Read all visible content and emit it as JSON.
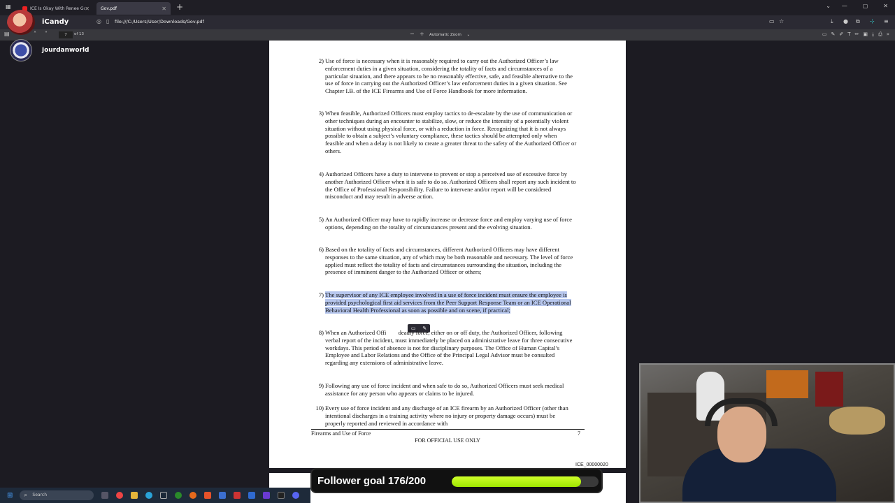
{
  "browser": {
    "tabs": [
      {
        "label": "ICE Is Okay With Renee Good's",
        "active": false
      },
      {
        "label": "Gov.pdf",
        "active": true
      }
    ],
    "url": "file:///C:/Users/User/Downloads/Gov.pdf"
  },
  "pdf_toolbar": {
    "page_current": "7",
    "page_total": "of 13",
    "zoom": "Automatic Zoom"
  },
  "overlay": {
    "user1": "iCandy",
    "user2": "jourdanworld"
  },
  "document": {
    "items": [
      {
        "num": "2)",
        "text": "Use of force is necessary when it is reasonably required to carry out the Authorized Officer’s law enforcement duties in a given situation, considering the totality of facts and circumstances of a particular situation, and there appears to be no reasonably effective, safe, and feasible alternative to the use of force in carrying out the Authorized Officer’s law enforcement duties in a given situation. See Chapter I.B. of the ICE Firearms and Use of Force Handbook for more information."
      },
      {
        "num": "3)",
        "text": "When feasible, Authorized Officers must employ tactics to de-escalate by the use of communication or other techniques during an encounter to stabilize, slow, or reduce the intensity of a potentially violent situation without using physical force, or with a reduction in force. Recognizing that it is not always possible to obtain a subject’s voluntary compliance, these tactics should be attempted only when feasible and when a delay is not likely to create a greater threat to the safety of the Authorized Officer or others."
      },
      {
        "num": "4)",
        "text": "Authorized Officers have a duty to intervene to prevent or stop a perceived use of excessive force by another Authorized Officer when it is safe to do so. Authorized Officers shall report any such incident to the Office of Professional Responsibility. Failure to intervene and/or report will be considered misconduct and may result in adverse action."
      },
      {
        "num": "5)",
        "text": "An Authorized Officer may have to rapidly increase or decrease force and employ varying use of force options, depending on the totality of circumstances present and the evolving situation."
      },
      {
        "num": "6)",
        "text": "Based on the totality of facts and circumstances, different Authorized Officers may have different responses to the same situation, any of which may be both reasonable and necessary. The level of force applied must reflect the totality of facts and circumstances surrounding the situation, including the presence of imminent danger to the Authorized Officer or others;"
      },
      {
        "num": "7)",
        "text": "The supervisor of any ICE employee involved in a use of force incident must ensure the employee is provided psychological first aid services from the Peer Support Response Team or an ICE Operational Behavioral Health Professional as soon as possible and on scene, if practical;"
      },
      {
        "num": "8)",
        "text": "When an Authorized Offi        deadly force, either on or off duty, the Authorized Officer, following verbal report of the incident, must immediately be placed on administrative leave for three consecutive workdays. This period of absence is not for disciplinary purposes. The Office of Human Capital’s Employee and Labor Relations and the Office of the Principal Legal Advisor must be consulted regarding any extensions of administrative leave."
      },
      {
        "num": "9)",
        "text": "Following any use of force incident and when safe to do so, Authorized Officers must seek medical assistance for any person who appears or claims to be injured."
      },
      {
        "num": "10)",
        "text": "Every use of force incident and any discharge of an ICE firearm by an Authorized Officer (other than intentional discharges in a training activity where no injury or property damage occurs) must be properly reported and reviewed in accordance with"
      }
    ],
    "footer_left": "Firearms and Use of Force",
    "footer_page": "7",
    "footer_center": "FOR OFFICIAL USE ONLY",
    "bates": "ICE_00000020"
  },
  "goal": {
    "label": "Follower goal 176/200",
    "current": 176,
    "target": 200
  },
  "taskbar": {
    "search_placeholder": "Search"
  },
  "colors": {
    "highlight": "#b7c7ee",
    "goal_fill": "#b4f014"
  }
}
